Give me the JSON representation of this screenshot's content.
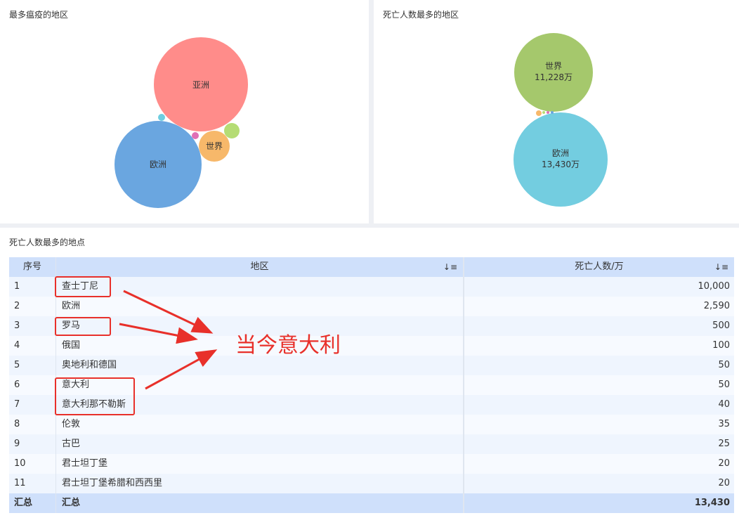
{
  "panel1": {
    "title": "最多瘟疫的地区",
    "bubbles": [
      {
        "label": "亚洲",
        "color": "#ff8c8a"
      },
      {
        "label": "欧洲",
        "color": "#6aa6e0"
      },
      {
        "label": "世界",
        "color": "#f7b86a"
      },
      {
        "label": "",
        "color": "#b5dc74"
      },
      {
        "label": "",
        "color": "#e070b5"
      },
      {
        "label": "",
        "color": "#6ecde0"
      }
    ]
  },
  "panel2": {
    "title": "死亡人数最多的地区",
    "bubbles": [
      {
        "label": "世界",
        "value": "11,228万",
        "color": "#a5c86c"
      },
      {
        "label": "欧洲",
        "value": "13,430万",
        "color": "#73cde0"
      }
    ]
  },
  "panel3": {
    "title": "死亡人数最多的地点",
    "headers": {
      "index": "序号",
      "region": "地区",
      "deaths": "死亡人数/万",
      "sort_icon": "↓≡"
    },
    "rows": [
      {
        "idx": "1",
        "region": "查士丁尼",
        "deaths": "10,000"
      },
      {
        "idx": "2",
        "region": "欧洲",
        "deaths": "2,590"
      },
      {
        "idx": "3",
        "region": "罗马",
        "deaths": "500"
      },
      {
        "idx": "4",
        "region": "俄国",
        "deaths": "100"
      },
      {
        "idx": "5",
        "region": "奥地利和德国",
        "deaths": "50"
      },
      {
        "idx": "6",
        "region": "意大利",
        "deaths": "50"
      },
      {
        "idx": "7",
        "region": "意大利那不勒斯",
        "deaths": "40"
      },
      {
        "idx": "8",
        "region": "伦敦",
        "deaths": "35"
      },
      {
        "idx": "9",
        "region": "古巴",
        "deaths": "25"
      },
      {
        "idx": "10",
        "region": "君士坦丁堡",
        "deaths": "20"
      },
      {
        "idx": "11",
        "region": "君士坦丁堡希腊和西西里",
        "deaths": "20"
      }
    ],
    "total": {
      "idx": "汇总",
      "region": "汇总",
      "deaths": "13,430"
    }
  },
  "annotation": {
    "text": "当今意大利",
    "color": "#e8302a"
  }
}
